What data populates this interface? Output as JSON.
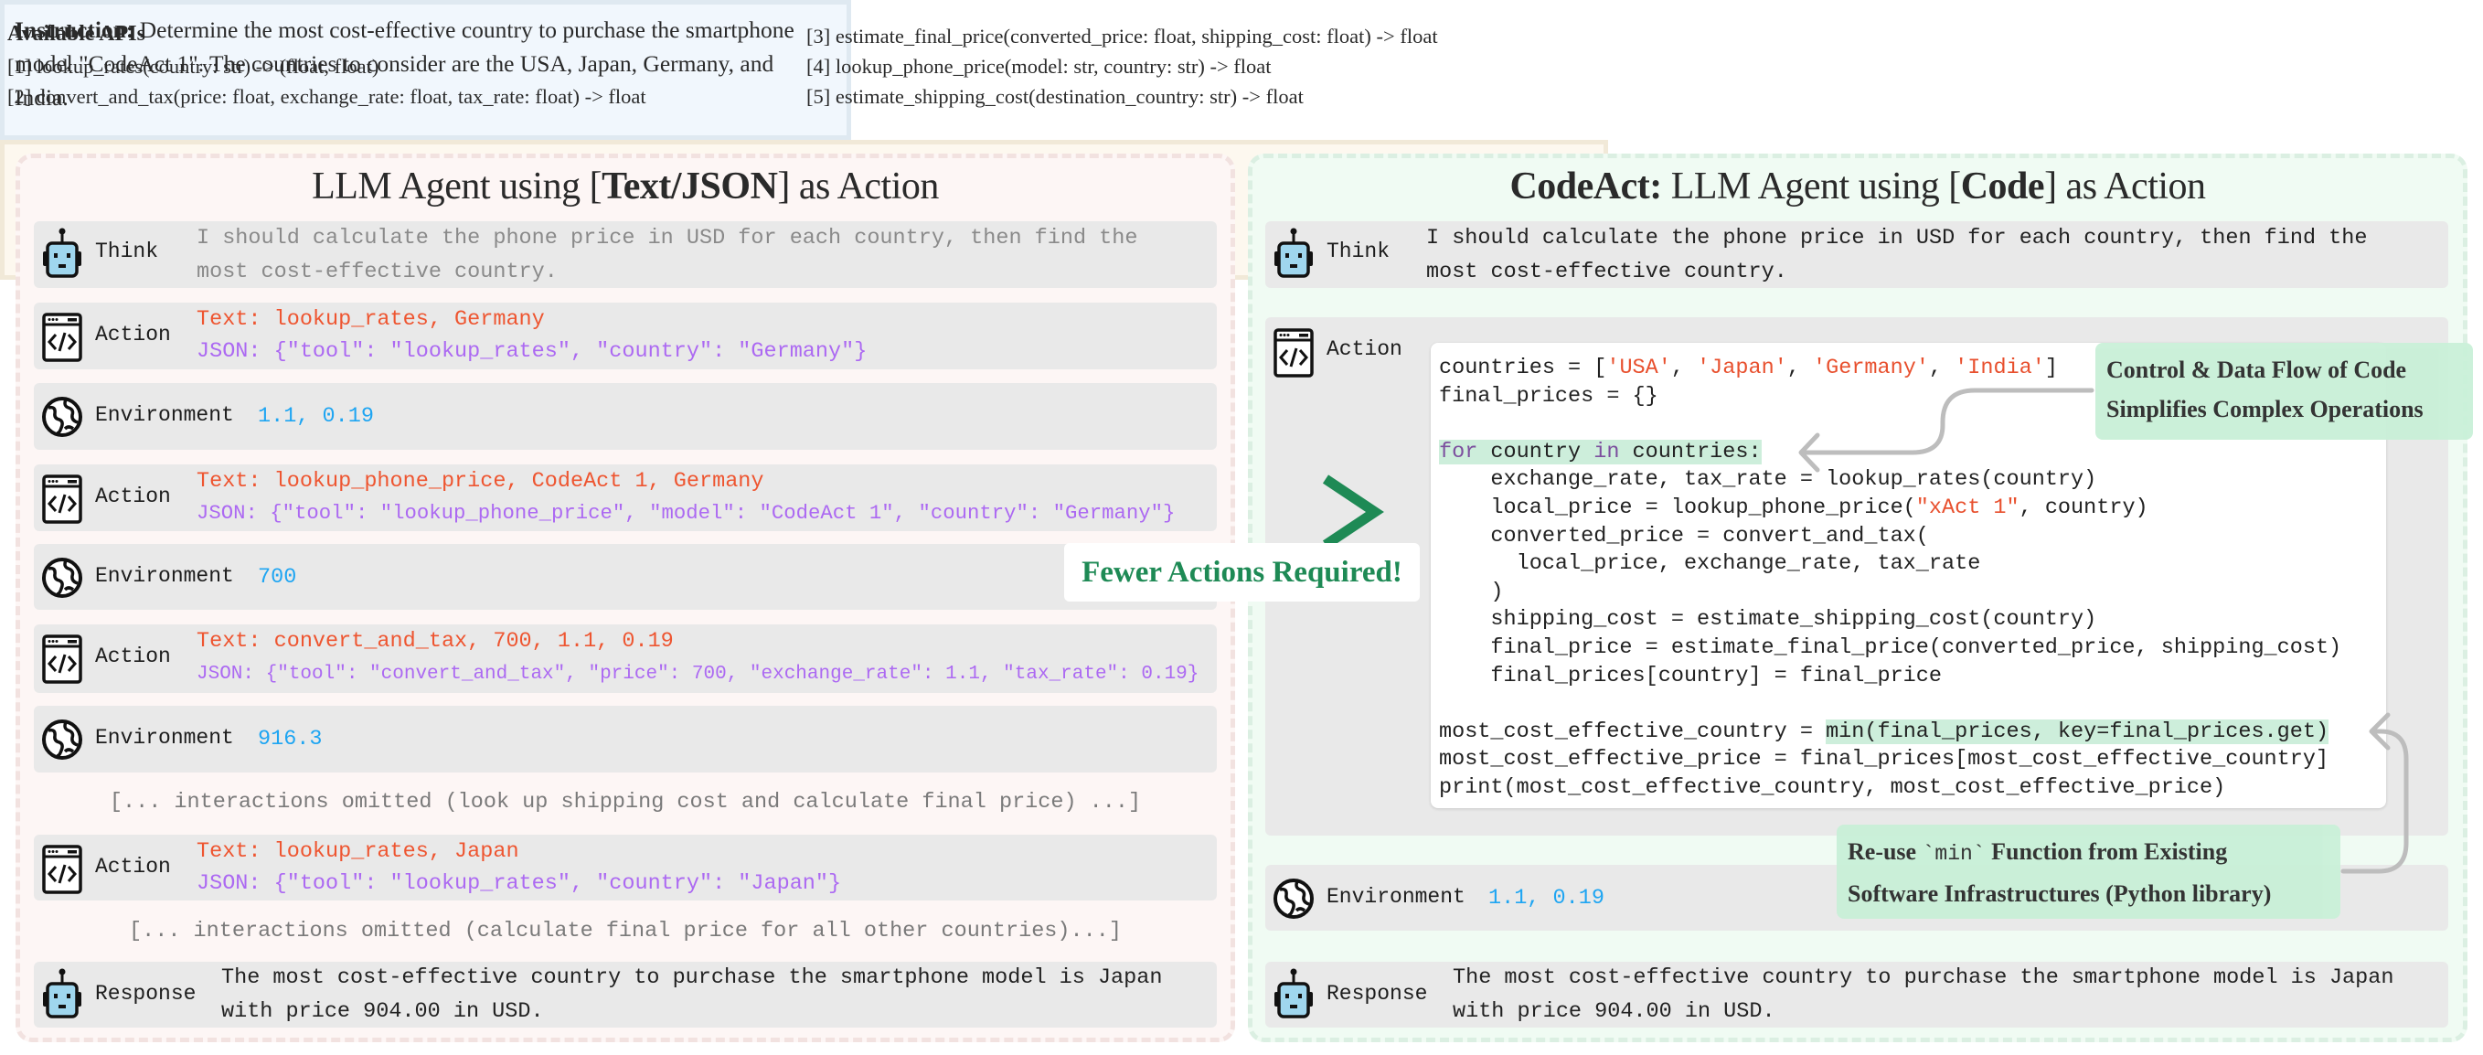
{
  "instruction": {
    "label": "Instruction:",
    "text": " Determine the most cost-effective country to purchase the smartphone model \"CodeAct 1\". The countries to consider are the USA, Japan, Germany, and India."
  },
  "apis": {
    "title": "Available APIs",
    "items": [
      "[1] lookup_rates(country: str) -> (float, float)",
      "[2] convert_and_tax(price: float, exchange_rate: float, tax_rate: float) -> float",
      "[3] estimate_final_price(converted_price: float, shipping_cost: float) -> float",
      "[4] lookup_phone_price(model: str, country: str) -> float",
      "[5] estimate_shipping_cost(destination_country: str) -> float"
    ]
  },
  "left": {
    "title_pre": "LLM Agent using [",
    "title_bold": "Text/JSON",
    "title_post": "] as Action",
    "rows": [
      {
        "label": "Think",
        "text": "I should calculate the phone price in USD for each country, then find the most cost-effective country."
      },
      {
        "label": "Action",
        "text": "Text: lookup_rates, Germany",
        "json": "JSON: {\"tool\": \"lookup_rates\", \"country\": \"Germany\"}"
      },
      {
        "label": "Environment",
        "value": "1.1, 0.19"
      },
      {
        "label": "Action",
        "text": "Text: lookup_phone_price, CodeAct 1, Germany",
        "json": "JSON: {\"tool\": \"lookup_phone_price\", \"model\": \"CodeAct 1\", \"country\": \"Germany\"}"
      },
      {
        "label": "Environment",
        "value": "700"
      },
      {
        "label": "Action",
        "text": "Text: convert_and_tax, 700, 1.1, 0.19",
        "json": "JSON: {\"tool\": \"convert_and_tax\", \"price\": 700, \"exchange_rate\": 1.1, \"tax_rate\": 0.19}"
      },
      {
        "label": "Environment",
        "value": "916.3"
      },
      {
        "label": "Action",
        "text": "Text: lookup_rates, Japan",
        "json": "JSON: {\"tool\": \"lookup_rates\", \"country\": \"Japan\"}"
      },
      {
        "label": "Response",
        "text": "The most cost-effective country to purchase the smartphone model is Japan with price 904.00 in USD."
      }
    ],
    "omitted": [
      "[... interactions omitted (look up shipping cost and calculate final price) ...]",
      "[... interactions omitted (calculate final price for all other countries)...]"
    ]
  },
  "right": {
    "title_bold1": "CodeAct:",
    "title_pre": " LLM Agent using [",
    "title_bold2": "Code",
    "title_post": "] as Action",
    "think": {
      "label": "Think",
      "text": "I should calculate the phone price in USD for each country, then find the most cost-effective country."
    },
    "action_label": "Action",
    "env": {
      "label": "Environment",
      "value": "1.1, 0.19"
    },
    "response": {
      "label": "Response",
      "text": "The most cost-effective country to purchase the smartphone model is Japan with price 904.00 in USD."
    },
    "code_lines": [
      [
        {
          "t": "countries = ["
        },
        {
          "t": "'USA'",
          "s": "str"
        },
        {
          "t": ", "
        },
        {
          "t": "'Japan'",
          "s": "str"
        },
        {
          "t": ", "
        },
        {
          "t": "'Germany'",
          "s": "str"
        },
        {
          "t": ", "
        },
        {
          "t": "'India'",
          "s": "str"
        },
        {
          "t": "]"
        }
      ],
      [
        {
          "t": "final_prices = {}"
        }
      ],
      [],
      [
        {
          "t": "for",
          "s": "kw hl"
        },
        {
          "t": " country ",
          "s": "hl"
        },
        {
          "t": "in",
          "s": "kw hl"
        },
        {
          "t": " countries:",
          "s": "hl"
        }
      ],
      [
        {
          "t": "    exchange_rate, tax_rate = lookup_rates(country)"
        }
      ],
      [
        {
          "t": "    local_price = lookup_phone_price("
        },
        {
          "t": "\"xAct 1\"",
          "s": "str"
        },
        {
          "t": ", country)"
        }
      ],
      [
        {
          "t": "    converted_price = convert_and_tax("
        }
      ],
      [
        {
          "t": "      local_price, exchange_rate, tax_rate"
        }
      ],
      [
        {
          "t": "    )"
        }
      ],
      [
        {
          "t": "    shipping_cost = estimate_shipping_cost(country)"
        }
      ],
      [
        {
          "t": "    final_price = estimate_final_price(converted_price, shipping_cost)"
        }
      ],
      [
        {
          "t": "    final_prices[country] = final_price"
        }
      ],
      [],
      [
        {
          "t": "most_cost_effective_country = "
        },
        {
          "t": "min(final_prices, key=final_prices.get)",
          "s": "hl"
        }
      ],
      [
        {
          "t": "most_cost_effective_price = final_prices[most_cost_effective_country]"
        }
      ],
      [
        {
          "t": "print(most_cost_effective_country, most_cost_effective_price)"
        }
      ]
    ]
  },
  "callouts": {
    "control_flow": [
      "Control & Data Flow of Code",
      "Simplifies Complex Operations"
    ],
    "reuse_pre": "Re-use ",
    "reuse_code": "`min`",
    "reuse_post": " Function from Existing",
    "reuse_line2": "Software Infrastructures (Python library)"
  },
  "comparison": {
    "symbol": ">",
    "label": "Fewer Actions Required!"
  },
  "colors": {
    "text_action": "#ee5530",
    "json_action": "#ac69f2",
    "env_value": "#1ea5f2",
    "highlight": "#cdeedb",
    "accent_green": "#1e8a55"
  },
  "icons": {
    "think": "robot-icon",
    "action": "code-window-icon",
    "environment": "globe-icon",
    "response": "robot-icon"
  }
}
